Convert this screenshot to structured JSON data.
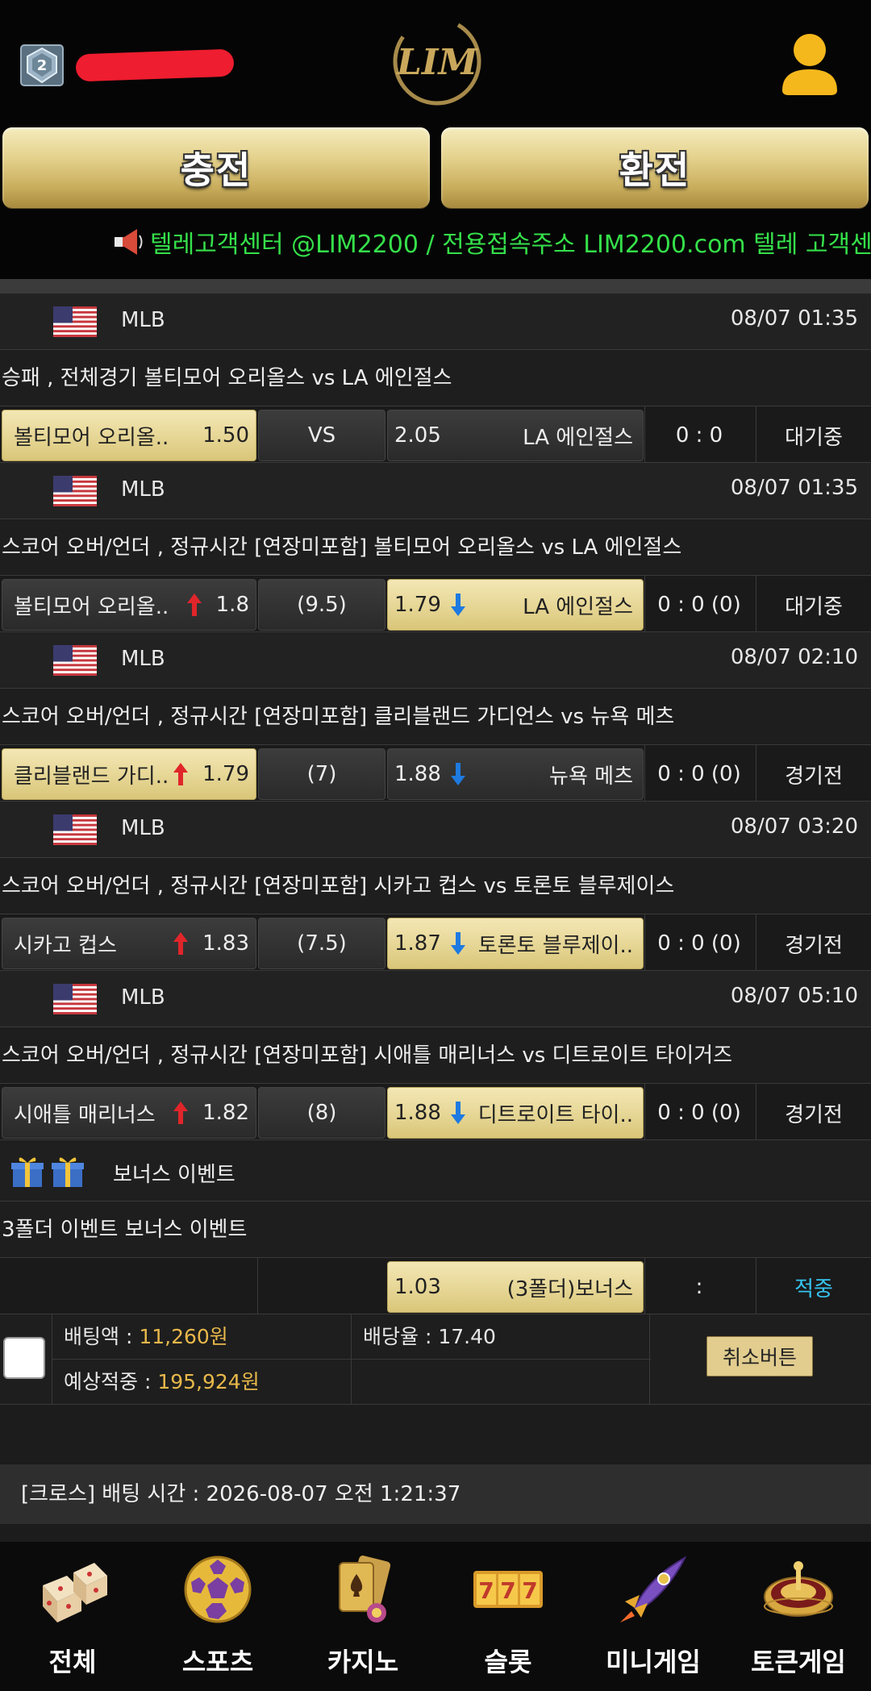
{
  "header": {
    "level": "2",
    "logo_text": "LIM",
    "charge_label": "충전",
    "exchange_label": "환전",
    "ticker": "텔레고객센터 @LIM2200 / 전용접속주소 LIM2200.com 텔레 고객센"
  },
  "colors": {
    "gold": "#e3d08a",
    "ticker": "#35e04a",
    "accent_cyan": "#35c4f0",
    "amount": "#e8b84a"
  },
  "bets": [
    {
      "league": "MLB",
      "time": "08/07 01:35",
      "market": "승패 , 전체경기 볼티모어 오리올스  vs  LA 에인절스",
      "home": "볼티모어 오리올..",
      "home_odds": "1.50",
      "home_arrow": "",
      "mid": "VS",
      "away_odds": "2.05",
      "away": "LA 에인절스",
      "away_arrow": "",
      "score": "0 : 0",
      "status": "대기중",
      "selected": "home"
    },
    {
      "league": "MLB",
      "time": "08/07 01:35",
      "market": "스코어 오버/언더 , 정규시간 [연장미포함] 볼티모어 오리올스  vs  LA 에인절스",
      "home": "볼티모어 오리올..",
      "home_odds": "1.8",
      "home_arrow": "up",
      "mid": "(9.5)",
      "away_odds": "1.79",
      "away": "LA 에인절스",
      "away_arrow": "down",
      "score": "0 : 0 (0)",
      "status": "대기중",
      "selected": "away"
    },
    {
      "league": "MLB",
      "time": "08/07 02:10",
      "market": "스코어 오버/언더 , 정규시간 [연장미포함] 클리블랜드 가디언스  vs  뉴욕 메츠",
      "home": "클리블랜드 가디..",
      "home_odds": "1.79",
      "home_arrow": "up",
      "mid": "(7)",
      "away_odds": "1.88",
      "away": "뉴욕 메츠",
      "away_arrow": "down",
      "score": "0 : 0 (0)",
      "status": "경기전",
      "selected": "home"
    },
    {
      "league": "MLB",
      "time": "08/07 03:20",
      "market": "스코어 오버/언더 , 정규시간 [연장미포함] 시카고 컵스  vs  토론토 블루제이스",
      "home": "시카고 컵스",
      "home_odds": "1.83",
      "home_arrow": "up",
      "mid": "(7.5)",
      "away_odds": "1.87",
      "away": "토론토 블루제이..",
      "away_arrow": "down",
      "score": "0 : 0 (0)",
      "status": "경기전",
      "selected": "away"
    },
    {
      "league": "MLB",
      "time": "08/07 05:10",
      "market": "스코어 오버/언더 , 정규시간 [연장미포함] 시애틀 매리너스  vs  디트로이트 타이거즈",
      "home": "시애틀 매리너스",
      "home_odds": "1.82",
      "home_arrow": "up",
      "mid": "(8)",
      "away_odds": "1.88",
      "away": "디트로이트 타이..",
      "away_arrow": "down",
      "score": "0 : 0 (0)",
      "status": "경기전",
      "selected": "away"
    }
  ],
  "bonus": {
    "title": "보너스 이벤트",
    "market": "3폴더 이벤트 보너스 이벤트",
    "odds": "1.03",
    "label": "(3폴더)보너스",
    "score": ":",
    "status": "적중"
  },
  "summary": {
    "bet_amount_label": "배팅액 : ",
    "bet_amount": "11,260원",
    "odds_label": "배당율 : 17.40",
    "expected_label": "예상적중 : ",
    "expected": "195,924원",
    "cancel_label": "취소버튼"
  },
  "next_section": "[크로스] 배팅 시간 : 2026-08-07 오전 1:21:37",
  "nav": [
    {
      "label": "전체",
      "icon": "dice-icon"
    },
    {
      "label": "스포츠",
      "icon": "soccer-ball-icon"
    },
    {
      "label": "카지노",
      "icon": "playing-cards-icon"
    },
    {
      "label": "슬롯",
      "icon": "slot-777-icon"
    },
    {
      "label": "미니게임",
      "icon": "rocket-icon"
    },
    {
      "label": "토큰게임",
      "icon": "roulette-icon"
    }
  ]
}
